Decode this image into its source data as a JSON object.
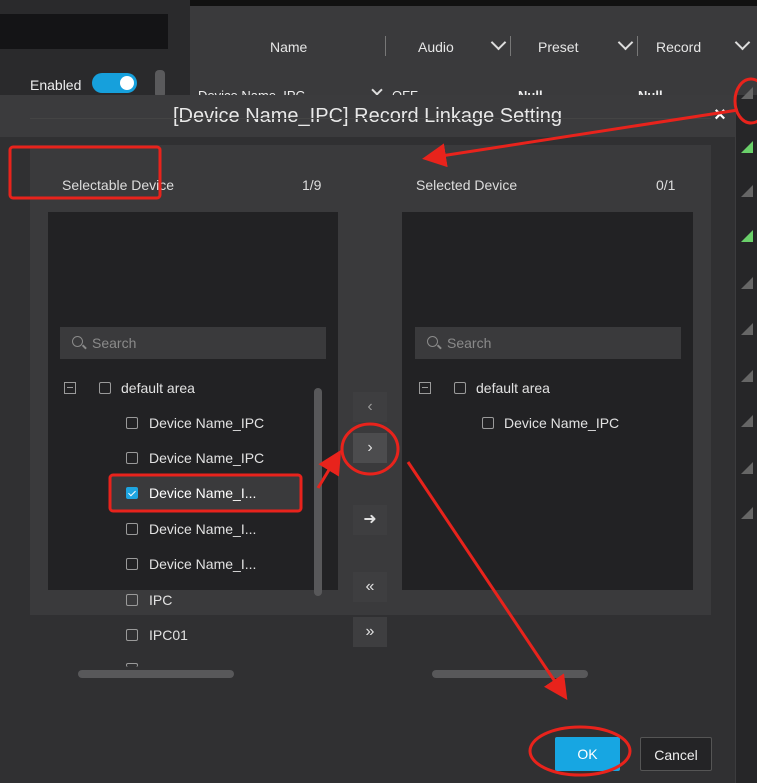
{
  "background": {
    "columns": [
      "Name",
      "Audio",
      "Preset",
      "Record"
    ],
    "row": {
      "name": "Device Name_IPC",
      "audio": "OFF",
      "preset": "Null",
      "record": "Null"
    }
  },
  "dialog": {
    "title": "[Device Name_IPC] Record Linkage Setting",
    "close_label": "×",
    "enabled_label": "Enabled",
    "enabled": true,
    "selectable": {
      "title": "Selectable Device",
      "count": "1/9",
      "search_placeholder": "Search",
      "group": "default area",
      "items": [
        {
          "label": "Device Name_IPC",
          "checked": false
        },
        {
          "label": "Device Name_IPC",
          "checked": false
        },
        {
          "label": "Device Name_I...",
          "checked": true
        },
        {
          "label": "Device Name_I...",
          "checked": false
        },
        {
          "label": "Device Name_I...",
          "checked": false
        },
        {
          "label": "IPC",
          "checked": false
        },
        {
          "label": "IPC01",
          "checked": false
        }
      ]
    },
    "selected": {
      "title": "Selected Device",
      "count": "0/1",
      "search_placeholder": "Search",
      "group": "default area",
      "items": [
        {
          "label": "Device Name_IPC",
          "checked": false
        }
      ]
    },
    "transfer_buttons": {
      "move_left": "‹",
      "move_right": "›",
      "move_all_arrow": "➜",
      "move_all_left": "«",
      "move_all_right": "»"
    },
    "ok_label": "OK",
    "cancel_label": "Cancel"
  },
  "colors": {
    "accent": "#17a6e2",
    "annotation": "#e8231c"
  }
}
